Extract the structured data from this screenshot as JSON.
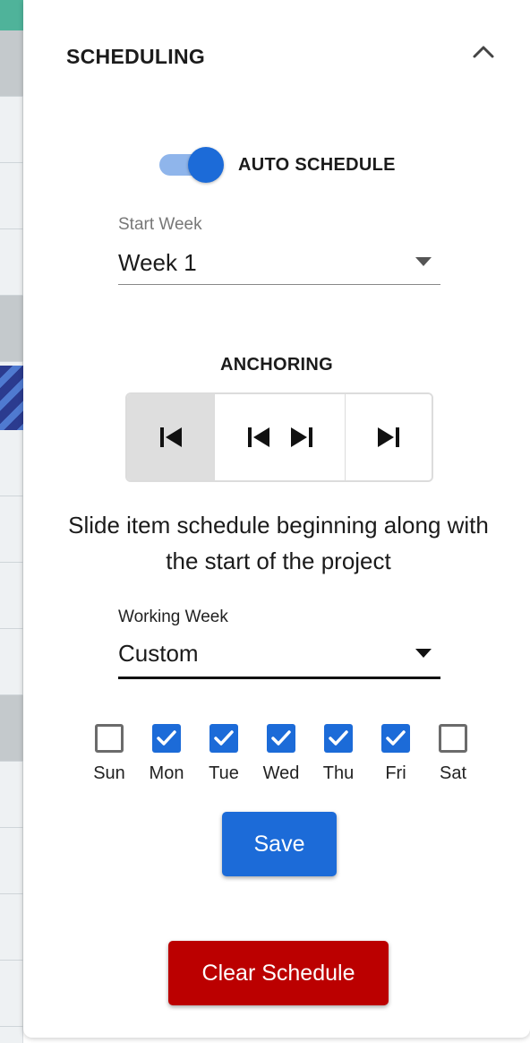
{
  "panel": {
    "title": "SCHEDULING"
  },
  "auto_schedule": {
    "label": "AUTO SCHEDULE",
    "enabled": true,
    "accent_color": "#1c6bd8"
  },
  "start_week": {
    "label": "Start Week",
    "value": "Week 1"
  },
  "anchoring": {
    "title": "ANCHORING",
    "options": [
      {
        "icon": "skip-to-start-icon",
        "selected": true
      },
      {
        "icon": "skip-start-and-end-icon",
        "selected": false
      },
      {
        "icon": "skip-to-end-icon",
        "selected": false
      }
    ],
    "description": "Slide item schedule beginning along with the start of the project"
  },
  "working_week": {
    "label": "Working Week",
    "value": "Custom",
    "days": [
      {
        "label": "Sun",
        "checked": false
      },
      {
        "label": "Mon",
        "checked": true
      },
      {
        "label": "Tue",
        "checked": true
      },
      {
        "label": "Wed",
        "checked": true
      },
      {
        "label": "Thu",
        "checked": true
      },
      {
        "label": "Fri",
        "checked": true
      },
      {
        "label": "Sat",
        "checked": false
      }
    ]
  },
  "buttons": {
    "save_label": "Save",
    "clear_label": "Clear Schedule",
    "save_color": "#1c6bd8",
    "clear_color": "#bb0000"
  }
}
